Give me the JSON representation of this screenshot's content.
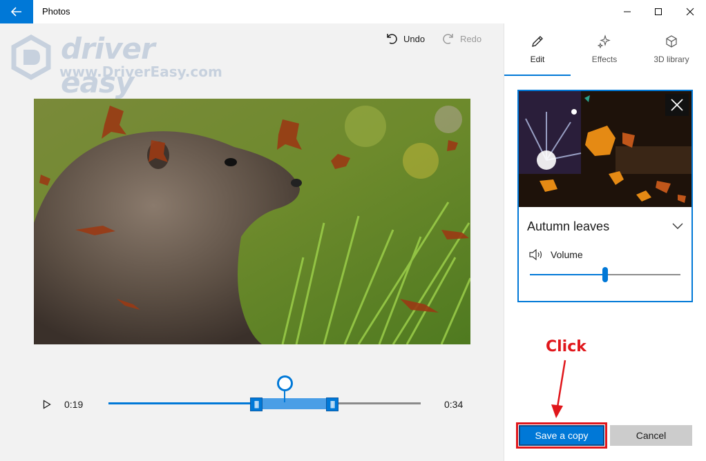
{
  "window": {
    "title": "Photos",
    "controls": [
      "minimize-icon",
      "maximize-icon",
      "close-icon"
    ]
  },
  "watermark": {
    "brand": "driver easy",
    "url": "www.DriverEasy.com"
  },
  "toolbar": {
    "undo_label": "Undo",
    "redo_label": "Redo"
  },
  "timeline": {
    "current_time": "0:19",
    "end_time": "0:34",
    "playhead_fraction": 0.56,
    "trim_start_fraction": 0.47,
    "trim_end_fraction": 0.71
  },
  "panel": {
    "tabs": [
      {
        "label": "Edit",
        "icon": "pencil-icon",
        "active": true
      },
      {
        "label": "Effects",
        "icon": "sparkle-icon",
        "active": false
      },
      {
        "label": "3D library",
        "icon": "cube-icon",
        "active": false
      }
    ],
    "effect": {
      "name": "Autumn leaves",
      "volume_label": "Volume",
      "volume_fraction": 0.5
    },
    "save_label": "Save a copy",
    "cancel_label": "Cancel"
  },
  "annotation": {
    "text": "Click",
    "color": "#e0161b"
  },
  "colors": {
    "accent": "#0078d7",
    "annotation": "#e0161b"
  }
}
